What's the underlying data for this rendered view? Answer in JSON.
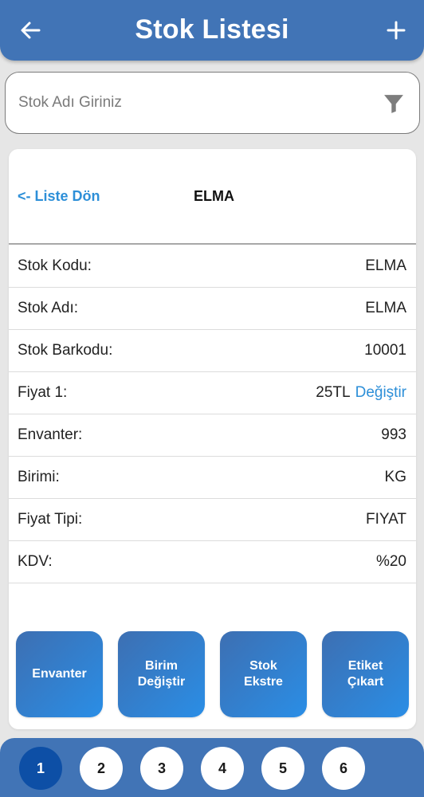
{
  "header": {
    "title": "Stok Listesi",
    "back_icon": "arrow-left-icon",
    "add_icon": "plus-icon"
  },
  "search": {
    "placeholder": "Stok Adı Giriniz",
    "value": "",
    "filter_icon": "filter-icon"
  },
  "detail": {
    "back_label": "<- Liste Dön",
    "title": "ELMA",
    "rows": [
      {
        "label": "Stok Kodu:",
        "value": "ELMA"
      },
      {
        "label": "Stok Adı:",
        "value": "ELMA"
      },
      {
        "label": "Stok Barkodu:",
        "value": "10001"
      },
      {
        "label": "Fiyat 1:",
        "value": "25TL",
        "action": "Değiştir"
      },
      {
        "label": "Envanter:",
        "value": "993"
      },
      {
        "label": "Birimi:",
        "value": "KG"
      },
      {
        "label": "Fiyat Tipi:",
        "value": "FIYAT"
      },
      {
        "label": "KDV:",
        "value": "%20"
      }
    ]
  },
  "actions": [
    {
      "label": "Envanter"
    },
    {
      "label": "Birim\nDeğiştir"
    },
    {
      "label": "Stok\nEkstre"
    },
    {
      "label": "Etiket\nÇıkart"
    }
  ],
  "pagination": {
    "pages": [
      "1",
      "2",
      "3",
      "4",
      "5",
      "6"
    ],
    "active": "1"
  },
  "colors": {
    "primary": "#4174b6",
    "link": "#2d8fd8",
    "active_page": "#0d4fa6"
  }
}
